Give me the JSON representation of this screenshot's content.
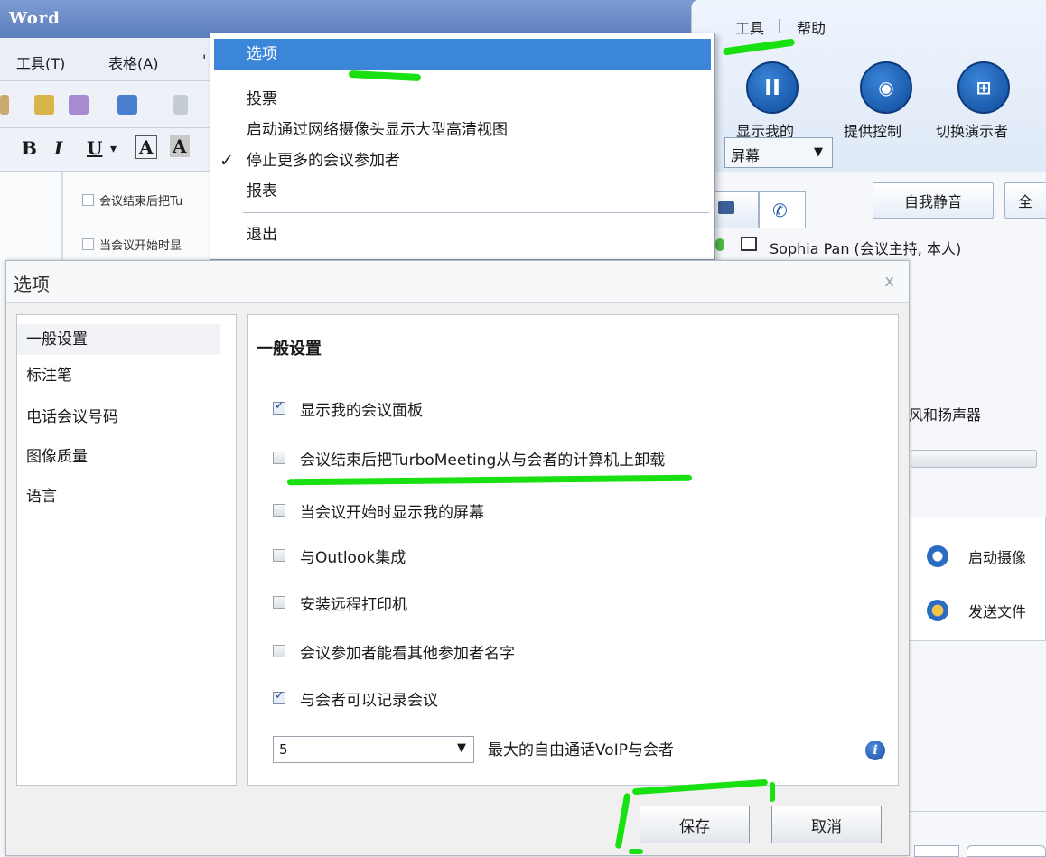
{
  "word": {
    "title": "Word",
    "menu": [
      "工具(T)",
      "表格(A)",
      "'"
    ],
    "doc_lines": [
      "会议结束后把Tu",
      "当会议开始时显"
    ]
  },
  "meeting": {
    "menu_tools": "工具",
    "menu_sep": "|",
    "menu_help": "帮助",
    "show_screen_l1": "显示我的",
    "show_screen_l2": "屏幕",
    "provide_control": "提供控制",
    "switch_presenter": "切换演示者",
    "mute_self": "自我静音",
    "mute_all_partial": "全",
    "participant": "Sophia Pan (会议主持, 本人)",
    "audio_partial": "风和扬声器",
    "start_camera_partial": "启动摄像",
    "send_file_partial": "发送文件"
  },
  "tools_menu": {
    "items": [
      "选项",
      "投票",
      "启动通过网络摄像头显示大型高清视图",
      "停止更多的会议参加者",
      "报表",
      "退出"
    ],
    "checked_index": 3,
    "checkmark": "✓"
  },
  "dialog": {
    "title": "选项",
    "close": "x",
    "nav": [
      "一般设置",
      "标注笔",
      "电话会议号码",
      "图像质量",
      "语言"
    ],
    "section_title": "一般设置",
    "options": [
      {
        "label": "显示我的会议面板",
        "checked": true
      },
      {
        "label": "会议结束后把TurboMeeting从与会者的计算机上卸载",
        "checked": false
      },
      {
        "label": "当会议开始时显示我的屏幕",
        "checked": false
      },
      {
        "label": "与Outlook集成",
        "checked": false
      },
      {
        "label": "安装远程打印机",
        "checked": false
      },
      {
        "label": "会议参加者能看其他参加者名字",
        "checked": false
      },
      {
        "label": "与会者可以记录会议",
        "checked": true
      }
    ],
    "voip_select_value": "5",
    "voip_label": "最大的自由通话VoIP与会者",
    "info": "i",
    "save": "保存",
    "cancel": "取消"
  },
  "colors": {
    "accent": "#3b86d9",
    "annotation": "#19e010"
  }
}
